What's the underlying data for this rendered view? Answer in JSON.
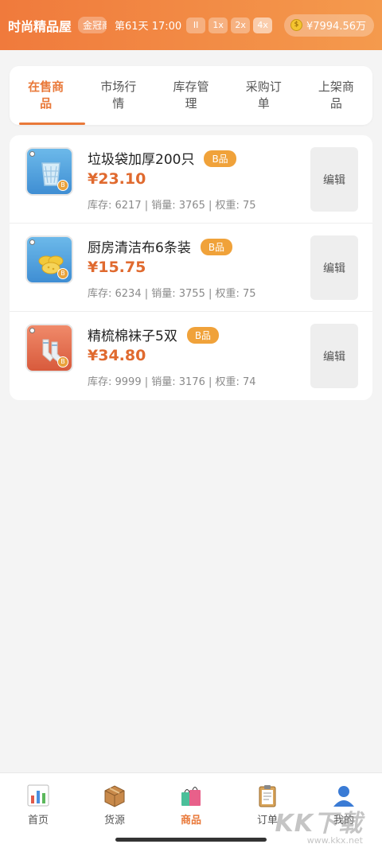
{
  "header": {
    "shop_name": "时尚精品屋",
    "level": "金冠商",
    "day_time": "第61天 17:00",
    "pause_label": "II",
    "speeds": [
      "1x",
      "2x",
      "4x"
    ],
    "active_speed": "4x",
    "money": "¥7994.56万",
    "coin_icon": "coin-bag-icon"
  },
  "tabs": [
    "在售商品",
    "市场行情",
    "库存管理",
    "采购订单",
    "上架商品"
  ],
  "active_tab": "在售商品",
  "products": [
    {
      "name": "垃圾袋加厚200只",
      "grade": "B品",
      "price": "¥23.10",
      "stats": "库存: 6217 | 销量: 3765 | 权重: 75",
      "icon": "trash-bin-icon",
      "thumb_color": "#4d9ee0",
      "edit_label": "编辑"
    },
    {
      "name": "厨房清洁布6条装",
      "grade": "B品",
      "price": "¥15.75",
      "stats": "库存: 6234 | 销量: 3755 | 权重: 75",
      "icon": "sponge-icon",
      "thumb_color": "#4d9ee0",
      "edit_label": "编辑"
    },
    {
      "name": "精梳棉袜子5双",
      "grade": "B品",
      "price": "¥34.80",
      "stats": "库存: 9999 | 销量: 3176 | 权重: 74",
      "icon": "socks-icon",
      "thumb_color": "#e06a4a",
      "edit_label": "编辑"
    }
  ],
  "thumb_grade_mark": "B",
  "bottom_nav": [
    {
      "label": "首页",
      "icon": "bar-chart-icon"
    },
    {
      "label": "货源",
      "icon": "package-icon"
    },
    {
      "label": "商品",
      "icon": "shopping-bags-icon"
    },
    {
      "label": "订单",
      "icon": "clipboard-icon"
    },
    {
      "label": "我的",
      "icon": "user-icon"
    }
  ],
  "active_nav": "商品",
  "watermark": {
    "logo": "KK下载",
    "url": "www.kkx.net"
  },
  "colors": {
    "accent": "#e9793a",
    "header_start": "#f07a3c",
    "header_end": "#f49a4d",
    "price": "#e06a2f",
    "grade_badge": "#f0a23a"
  }
}
